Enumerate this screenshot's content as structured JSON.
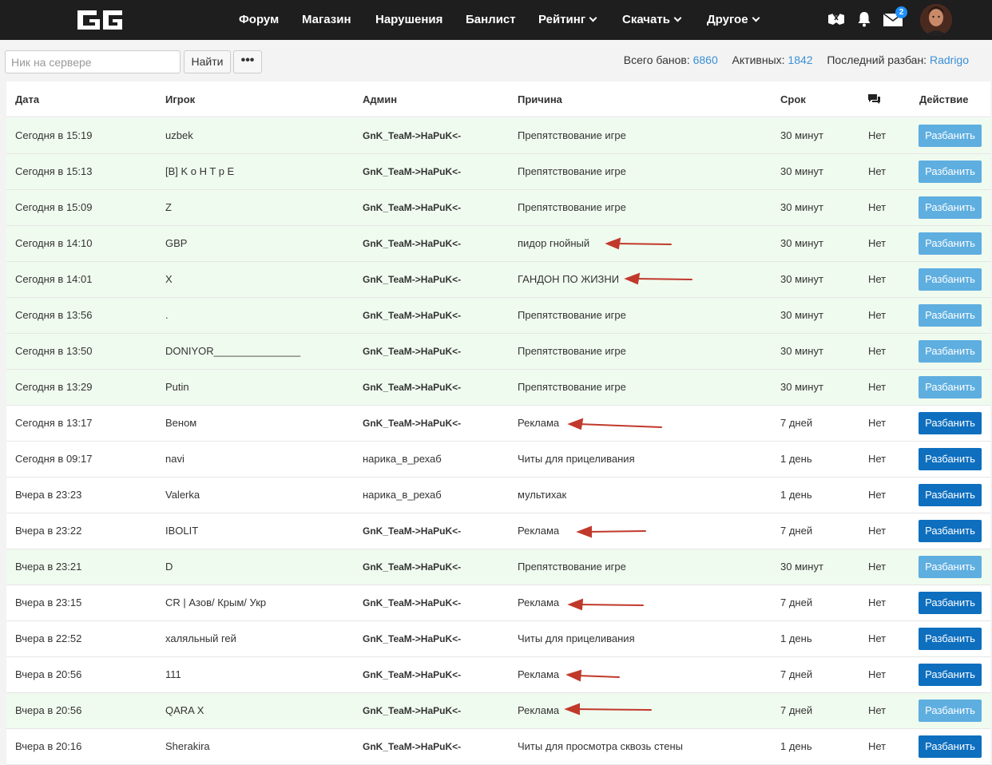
{
  "nav": {
    "items": [
      {
        "label": "Форум",
        "dropdown": false
      },
      {
        "label": "Магазин",
        "dropdown": false
      },
      {
        "label": "Нарушения",
        "dropdown": false
      },
      {
        "label": "Банлист",
        "dropdown": false
      },
      {
        "label": "Рейтинг",
        "dropdown": true
      },
      {
        "label": "Скачать",
        "dropdown": true
      },
      {
        "label": "Другое",
        "dropdown": true
      }
    ],
    "messages_badge": "2"
  },
  "search": {
    "placeholder": "Ник на сервере",
    "find_label": "Найти",
    "more_label": "•••"
  },
  "stats": {
    "total_label": "Всего банов:",
    "total_value": "6860",
    "active_label": "Активных:",
    "active_value": "1842",
    "last_unban_label": "Последний разбан:",
    "last_unban_value": "Radrigo"
  },
  "table": {
    "headers": {
      "date": "Дата",
      "player": "Игрок",
      "admin": "Админ",
      "reason": "Причина",
      "term": "Срок",
      "action": "Действие"
    },
    "unban_label": "Разбанить",
    "rows": [
      {
        "date": "Сегодня в 15:19",
        "player": "uzbek",
        "admin": "GnK_TeaM->HaPuK<-",
        "admin_bold": true,
        "reason": "Препятствование игре",
        "term": "30 минут",
        "comments": "Нет",
        "active": true
      },
      {
        "date": "Сегодня в 15:13",
        "player": "[B] K o H T p E",
        "admin": "GnK_TeaM->HaPuK<-",
        "admin_bold": true,
        "reason": "Препятствование игре",
        "term": "30 минут",
        "comments": "Нет",
        "active": true
      },
      {
        "date": "Сегодня в 15:09",
        "player": "Z",
        "admin": "GnK_TeaM->HaPuK<-",
        "admin_bold": true,
        "reason": "Препятствование игре",
        "term": "30 минут",
        "comments": "Нет",
        "active": true
      },
      {
        "date": "Сегодня в 14:10",
        "player": "GBP",
        "admin": "GnK_TeaM->HaPuK<-",
        "admin_bold": true,
        "reason": "пидор гнойный",
        "term": "30 минут",
        "comments": "Нет",
        "active": true
      },
      {
        "date": "Сегодня в 14:01",
        "player": "X",
        "admin": "GnK_TeaM->HaPuK<-",
        "admin_bold": true,
        "reason": "ГАНДОН ПО ЖИЗНИ",
        "term": "30 минут",
        "comments": "Нет",
        "active": true
      },
      {
        "date": "Сегодня в 13:56",
        "player": ".",
        "admin": "GnK_TeaM->HaPuK<-",
        "admin_bold": true,
        "reason": "Препятствование игре",
        "term": "30 минут",
        "comments": "Нет",
        "active": true
      },
      {
        "date": "Сегодня в 13:50",
        "player": "DONIYOR_______________",
        "admin": "GnK_TeaM->HaPuK<-",
        "admin_bold": true,
        "reason": "Препятствование игре",
        "term": "30 минут",
        "comments": "Нет",
        "active": true
      },
      {
        "date": "Сегодня в 13:29",
        "player": "Putin",
        "admin": "GnK_TeaM->HaPuK<-",
        "admin_bold": true,
        "reason": "Препятствование игре",
        "term": "30 минут",
        "comments": "Нет",
        "active": true
      },
      {
        "date": "Сегодня в 13:17",
        "player": "Веном",
        "admin": "GnK_TeaM->HaPuK<-",
        "admin_bold": true,
        "reason": "Реклама",
        "term": "7 дней",
        "comments": "Нет",
        "active": false
      },
      {
        "date": "Сегодня в 09:17",
        "player": "navi",
        "admin": "нарика_в_рехаб",
        "admin_bold": false,
        "reason": "Читы для прицеливания",
        "term": "1 день",
        "comments": "Нет",
        "active": false
      },
      {
        "date": "Вчера в 23:23",
        "player": "Valerka",
        "admin": "нарика_в_рехаб",
        "admin_bold": false,
        "reason": "мультихак",
        "term": "1 день",
        "comments": "Нет",
        "active": false
      },
      {
        "date": "Вчера в 23:22",
        "player": "IBOLIT",
        "admin": "GnK_TeaM->HaPuK<-",
        "admin_bold": true,
        "reason": "Реклама",
        "term": "7 дней",
        "comments": "Нет",
        "active": false
      },
      {
        "date": "Вчера в 23:21",
        "player": "D",
        "admin": "GnK_TeaM->HaPuK<-",
        "admin_bold": true,
        "reason": "Препятствование игре",
        "term": "30 минут",
        "comments": "Нет",
        "active": true
      },
      {
        "date": "Вчера в 23:15",
        "player": "CR | Азов/ Крым/ Укр",
        "admin": "GnK_TeaM->HaPuK<-",
        "admin_bold": true,
        "reason": "Реклама",
        "term": "7 дней",
        "comments": "Нет",
        "active": false
      },
      {
        "date": "Вчера в 22:52",
        "player": "халяльный гей",
        "admin": "GnK_TeaM->HaPuK<-",
        "admin_bold": true,
        "reason": "Читы для прицеливания",
        "term": "1 день",
        "comments": "Нет",
        "active": false
      },
      {
        "date": "Вчера в 20:56",
        "player": "111",
        "admin": "GnK_TeaM->HaPuK<-",
        "admin_bold": true,
        "reason": "Реклама",
        "term": "7 дней",
        "comments": "Нет",
        "active": false
      },
      {
        "date": "Вчера в 20:56",
        "player": "QARA X",
        "admin": "GnK_TeaM->HaPuK<-",
        "admin_bold": true,
        "reason": "Реклама",
        "term": "7 дней",
        "comments": "Нет",
        "active": true
      },
      {
        "date": "Вчера в 20:16",
        "player": "Sherakira",
        "admin": "GnK_TeaM->HaPuK<-",
        "admin_bold": true,
        "reason": "Читы для просмотра сквозь стены",
        "term": "1 день",
        "comments": "Нет",
        "active": false
      }
    ]
  },
  "colors": {
    "navbar": "#1e1e1e",
    "link": "#3a8fd6",
    "active_row": "#f0fbef",
    "unban_button": "#0e6fbf",
    "unban_button_active": "#5eaee0",
    "annotation_arrow": "#c0392b"
  },
  "icons": [
    "logo",
    "chevron-down-icon",
    "handshake-icon",
    "bell-icon",
    "envelope-icon",
    "avatar",
    "comment-icon"
  ]
}
